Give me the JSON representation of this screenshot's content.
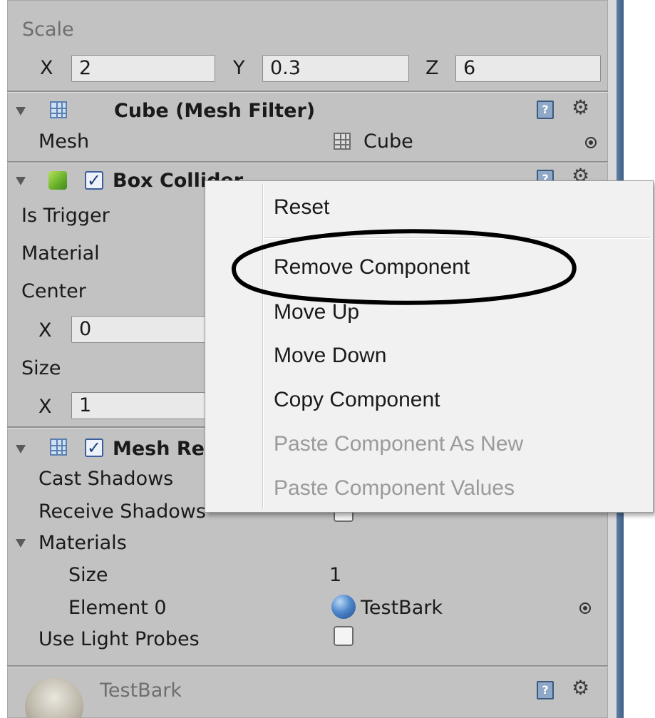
{
  "transform": {
    "scale_label": "Scale",
    "x_label": "X",
    "x_value": "2",
    "y_label": "Y",
    "y_value": "0.3",
    "z_label": "Z",
    "z_value": "6"
  },
  "mesh_filter": {
    "title": "Cube (Mesh Filter)",
    "mesh_label": "Mesh",
    "mesh_value": "Cube"
  },
  "box_collider": {
    "title": "Box Collider",
    "enabled": true,
    "is_trigger_label": "Is Trigger",
    "material_label": "Material",
    "center_label": "Center",
    "center_x_label": "X",
    "center_x_value": "0",
    "size_label": "Size",
    "size_x_label": "X",
    "size_x_value": "1"
  },
  "mesh_renderer": {
    "title": "Mesh Renderer",
    "enabled": true,
    "cast_shadows_label": "Cast Shadows",
    "receive_shadows_label": "Receive Shadows",
    "materials_label": "Materials",
    "size_label": "Size",
    "size_value": "1",
    "element0_label": "Element 0",
    "element0_value": "TestBark",
    "use_light_probes_label": "Use Light Probes",
    "use_light_probes_checked": false
  },
  "material_preview": {
    "name": "TestBark"
  },
  "context_menu": {
    "items": [
      {
        "label": "Reset",
        "enabled": true
      },
      {
        "label": "Remove Component",
        "enabled": true,
        "circled": true
      },
      {
        "label": "Move Up",
        "enabled": true
      },
      {
        "label": "Move Down",
        "enabled": true
      },
      {
        "label": "Copy Component",
        "enabled": true
      },
      {
        "label": "Paste Component As New",
        "enabled": false
      },
      {
        "label": "Paste Component Values",
        "enabled": false
      }
    ]
  },
  "icons": {
    "fold": "triangle-down-icon",
    "mesh_filter": "mesh-grid-icon",
    "box_collider": "green-cube-icon",
    "mesh_renderer": "mesh-renderer-icon",
    "help": "help-book-icon",
    "settings": "gear-icon",
    "object_picker": "object-picker-icon",
    "material": "sphere-material-icon"
  },
  "colors": {
    "inspector_bg": "#c2c2c2",
    "menu_bg": "#f1f1f1",
    "disabled_text": "#9a9a9a",
    "ellipse": "#000000"
  }
}
